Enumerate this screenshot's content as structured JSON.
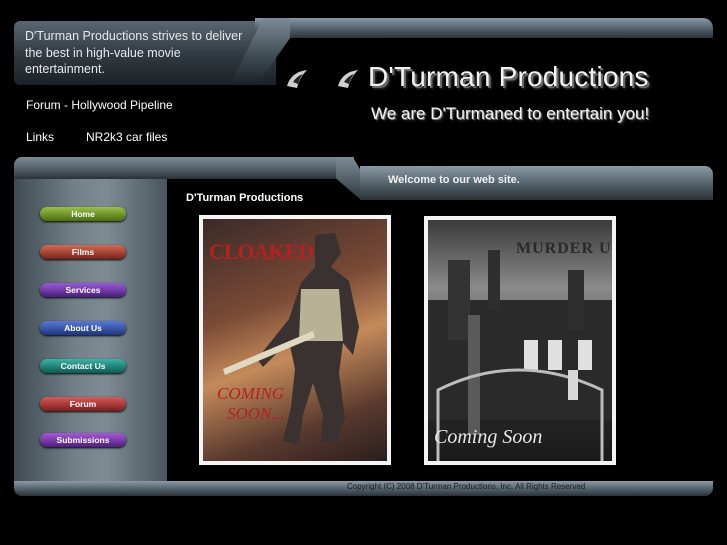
{
  "header": {
    "tagline": "D'Turman Productions strives to deliver the best in high-value movie entertainment.",
    "brand_title": "D'Turman Productions",
    "slogan": "We are D'Turmaned to entertain you!"
  },
  "top_links": {
    "forum": "Forum - Hollywood Pipeline",
    "links": "Links",
    "nr2k3": "NR2k3 car files"
  },
  "banner": {
    "welcome": "Welcome to our web site."
  },
  "sidebar": {
    "items": [
      {
        "label": "Home",
        "color": "#7aa62e"
      },
      {
        "label": "Films",
        "color": "#b2463a"
      },
      {
        "label": "Services",
        "color": "#7a3ab2"
      },
      {
        "label": "About Us",
        "color": "#3a5ab2"
      },
      {
        "label": "Contact Us",
        "color": "#1e8c7e"
      },
      {
        "label": "Forum",
        "color": "#b23a3a"
      },
      {
        "label": "Submissions",
        "color": "#843ab2"
      }
    ]
  },
  "main": {
    "section_title": "D'Turman Productions",
    "posters": [
      {
        "title": "CLOAKED",
        "caption_line1": "COMING",
        "caption_line2": "SOON..."
      },
      {
        "title": "MURDER U",
        "caption": "Coming Soon"
      }
    ]
  },
  "footer": {
    "copyright": "Copyright (C) 2008 D'Turman Productions, Inc. All Rights Reserved"
  }
}
